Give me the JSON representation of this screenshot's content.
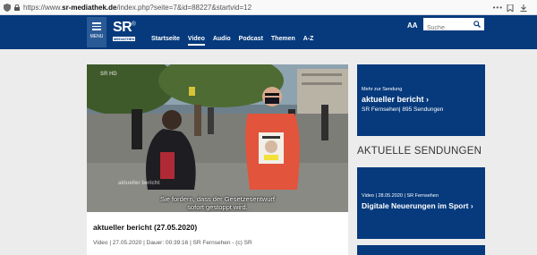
{
  "browser": {
    "url_prefix": "https://www.",
    "url_domain": "sr-mediathek.de",
    "url_path": "/index.php?seite=7&id=88227&startvid=12",
    "more_dots": "•••"
  },
  "header": {
    "menu_label": "MENU",
    "logo_text": "SR",
    "logo_mark": "®",
    "logo_sub": "MEDIATHEK",
    "nav": [
      {
        "label": "Startseite"
      },
      {
        "label": "Video"
      },
      {
        "label": "Audio"
      },
      {
        "label": "Podcast"
      },
      {
        "label": "Themen"
      },
      {
        "label": "A-Z"
      }
    ],
    "active_nav": "Video",
    "font_size_toggle": "AA",
    "search_placeholder": "Suche"
  },
  "video": {
    "channel_bug": "SR HD",
    "watermark": "aktueller bericht",
    "subtitle_line1": "Sie fordern, dass der Gesetzesentwurf",
    "subtitle_line2": "sofort gestoppt wird.",
    "title": "aktueller bericht (27.05.2020)",
    "meta": "Video | 27.05.2020 | Dauer: 00:39:16 | SR Fernsehen - (c) SR"
  },
  "sidebar": {
    "promo": {
      "kicker": "Mehr zur Sendung",
      "title": "aktueller bericht ›",
      "subtitle": "SR Fernsehen| 895 Sendungen"
    },
    "section_heading": "AKTUELLE SENDUNGEN",
    "sendungen": [
      {
        "kicker": "Video | 28.05.2020 | SR Fernsehen",
        "title": "Digitale Neuerungen im Sport ›"
      }
    ]
  },
  "colors": {
    "brand_blue": "#063a7d",
    "menu_blue": "#2a5a96",
    "page_bg": "#ececec"
  },
  "icons": [
    "shield-icon",
    "lock-icon",
    "menu-icon",
    "search-icon",
    "bookmark-icon",
    "download-icon"
  ]
}
